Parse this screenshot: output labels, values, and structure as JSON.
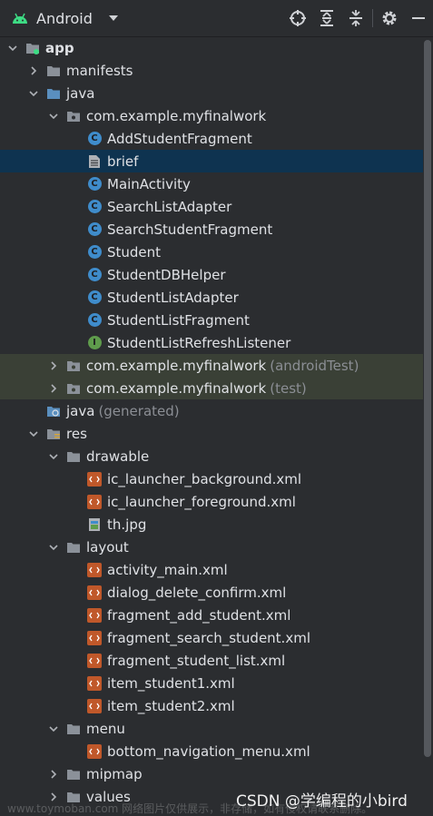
{
  "toolbar": {
    "view_label": "Android"
  },
  "tree": {
    "app": "app",
    "manifests": "manifests",
    "java": "java",
    "package_main": "com.example.myfinalwork",
    "files": {
      "add_student_fragment": "AddStudentFragment",
      "brief": "brief",
      "main_activity": "MainActivity",
      "search_list_adapter": "SearchListAdapter",
      "search_student_fragment": "SearchStudentFragment",
      "student": "Student",
      "student_db_helper": "StudentDBHelper",
      "student_list_adapter": "StudentListAdapter",
      "student_list_fragment": "StudentListFragment",
      "student_list_refresh_listener": "StudentListRefreshListener"
    },
    "package_android_test": "com.example.myfinalwork",
    "android_test_suffix": "(androidTest)",
    "package_test": "com.example.myfinalwork",
    "test_suffix": "(test)",
    "java_generated": "java",
    "generated_suffix": "(generated)",
    "res": "res",
    "drawable": "drawable",
    "drawable_files": {
      "bg": "ic_launcher_background.xml",
      "fg": "ic_launcher_foreground.xml",
      "th": "th.jpg"
    },
    "layout": "layout",
    "layout_files": {
      "activity_main": "activity_main.xml",
      "dialog_delete": "dialog_delete_confirm.xml",
      "fragment_add": "fragment_add_student.xml",
      "fragment_search": "fragment_search_student.xml",
      "fragment_list": "fragment_student_list.xml",
      "item1": "item_student1.xml",
      "item2": "item_student2.xml"
    },
    "menu": "menu",
    "menu_files": {
      "bottom_nav": "bottom_navigation_menu.xml"
    },
    "mipmap": "mipmap",
    "values": "values"
  },
  "watermark": {
    "csdn": "CSDN @学编程的小bird",
    "faint": "www.toymoban.com 网络图片仅供展示，非存储，如有侵权请联系删除。"
  },
  "colors": {
    "background": "#2b2d30",
    "selection": "#0e3350",
    "test_highlight": "#3a4036",
    "class_icon": "#3f8ccb",
    "interface_icon": "#5f9c4c",
    "xml_icon": "#c0582a"
  }
}
